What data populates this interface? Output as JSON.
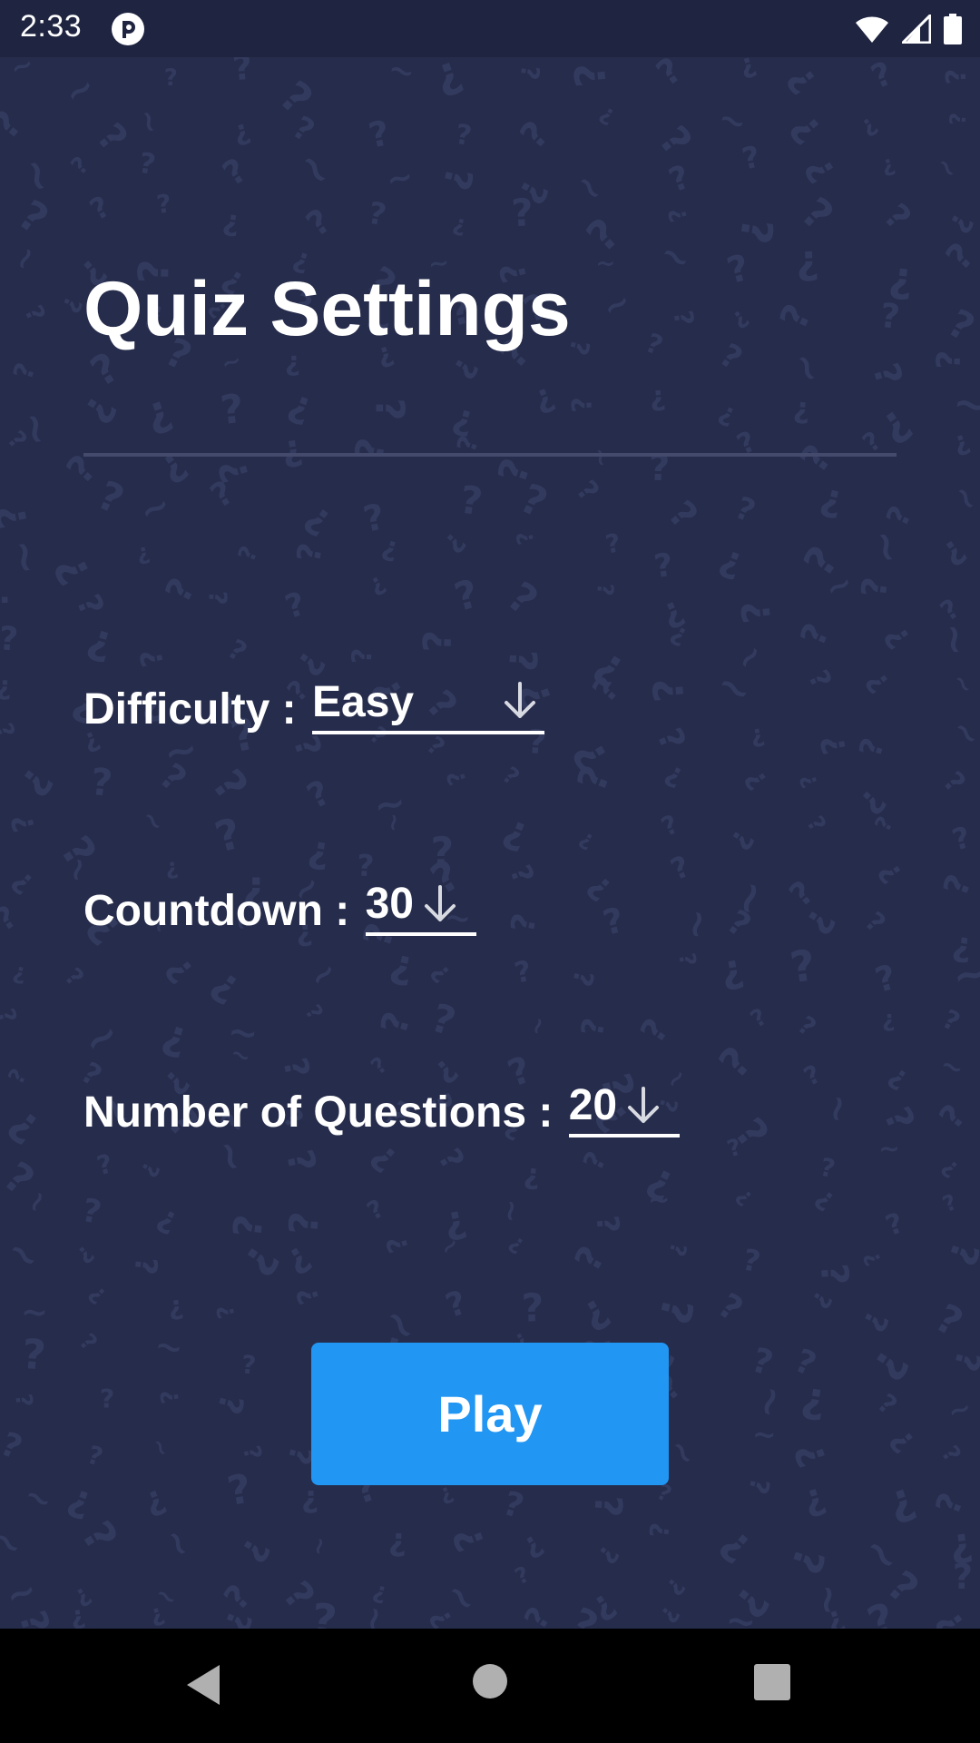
{
  "status_bar": {
    "time": "2:33",
    "icons": [
      "app-notification-icon",
      "wifi-icon",
      "cell-signal-icon",
      "battery-icon"
    ]
  },
  "screen": {
    "title": "Quiz Settings",
    "settings": [
      {
        "label": "Difficulty : ",
        "value": "Easy"
      },
      {
        "label": "Countdown : ",
        "value": "30"
      },
      {
        "label": "Number of Questions : ",
        "value": "20"
      }
    ],
    "play_label": "Play"
  },
  "colors": {
    "background": "#262c4b",
    "status_bar": "#1f2440",
    "accent": "#2196f3",
    "divider": "#434a6c",
    "nav_bar": "#000000"
  },
  "nav_bar": {
    "icons": [
      "back-icon",
      "home-icon",
      "recents-icon"
    ]
  }
}
